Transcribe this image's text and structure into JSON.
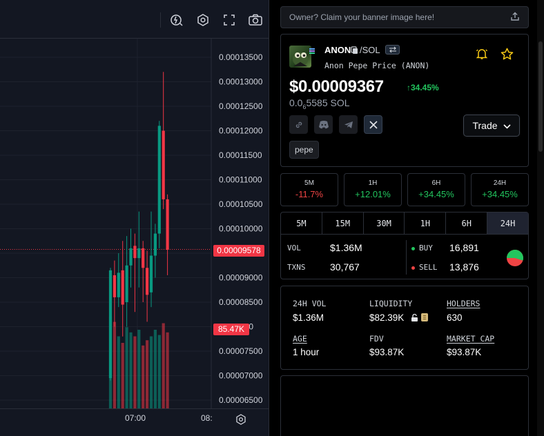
{
  "chart": {
    "price_axis": [
      "0.00013500",
      "0.00013000",
      "0.00012500",
      "0.00012000",
      "0.00011500",
      "0.00011000",
      "0.00010500",
      "0.00010000",
      "0.00009000",
      "0.00008500",
      "0.00007500",
      "0.00007000",
      "0.00006500"
    ],
    "partial_price_label": "000",
    "current_price_tag": "0.00009578",
    "volume_tag": "85.47K",
    "time_labels": [
      "07:00",
      "08:"
    ],
    "candles": [
      {
        "o": 6.95e-05,
        "c": 9.15e-05,
        "h": 9.2e-05,
        "l": 6.9e-05,
        "v": 70
      },
      {
        "o": 9.05e-05,
        "c": 8.6e-05,
        "h": 9.35e-05,
        "l": 8e-05,
        "v": 66
      },
      {
        "o": 8.6e-05,
        "c": 9.1e-05,
        "h": 9.5e-05,
        "l": 8.4e-05,
        "v": 55
      },
      {
        "o": 9.15e-05,
        "c": 8.45e-05,
        "h": 9.75e-05,
        "l": 7.8e-05,
        "v": 50
      },
      {
        "o": 8.5e-05,
        "c": 9.25e-05,
        "h": 9.85e-05,
        "l": 8e-05,
        "v": 62
      },
      {
        "o": 9.25e-05,
        "c": 9.6e-05,
        "h": 0.0001,
        "l": 8.8e-05,
        "v": 58
      },
      {
        "o": 9.65e-05,
        "c": 9.4e-05,
        "h": 9.9e-05,
        "l": 8.3e-05,
        "v": 55
      },
      {
        "o": 9.4e-05,
        "c": 9.6e-05,
        "h": 0.0001035,
        "l": 8.8e-05,
        "v": 60
      },
      {
        "o": 9.6e-05,
        "c": 9.2e-05,
        "h": 9.75e-05,
        "l": 8.5e-05,
        "v": 48
      },
      {
        "o": 9.2e-05,
        "c": 8.65e-05,
        "h": 9.55e-05,
        "l": 8.1e-05,
        "v": 52
      },
      {
        "o": 8.7e-05,
        "c": 9.45e-05,
        "h": 0.0001035,
        "l": 8.4e-05,
        "v": 55
      },
      {
        "o": 9.45e-05,
        "c": 9.9e-05,
        "h": 0.000101,
        "l": 9e-05,
        "v": 60
      },
      {
        "o": 9.9e-05,
        "c": 0.000121,
        "h": 0.000122,
        "l": 9.6e-05,
        "v": 56
      },
      {
        "o": 0.00012,
        "c": 0.000106,
        "h": 0.000132,
        "l": 0.000104,
        "v": 65
      },
      {
        "o": 0.000106,
        "c": 9.57e-05,
        "h": 0.000107,
        "l": 9.05e-05,
        "v": 58
      }
    ]
  },
  "banner": {
    "text": "Owner? Claim your banner image here!"
  },
  "token": {
    "symbol": "ANON",
    "quote": "/SOL",
    "fullname": "Anon Pepe Price (ANON)",
    "price_usd": "$0.00009367",
    "change_24h": "34.45%",
    "price_native_prefix": "0.0",
    "price_native_sub": "6",
    "price_native_rest": "5585 SOL",
    "trade_label": "Trade",
    "tag": "pepe"
  },
  "changes": [
    {
      "label": "5M",
      "value": "-11.7%",
      "direction": "down"
    },
    {
      "label": "1H",
      "value": "+12.01%",
      "direction": "up"
    },
    {
      "label": "6H",
      "value": "+34.45%",
      "direction": "up"
    },
    {
      "label": "24H",
      "value": "+34.45%",
      "direction": "up"
    }
  ],
  "timeframes": [
    "5M",
    "15M",
    "30M",
    "1H",
    "6H",
    "24H"
  ],
  "active_timeframe": "24H",
  "stats": {
    "vol_label": "VOL",
    "vol_value": "$1.36M",
    "txns_label": "TXNS",
    "txns_value": "30,767",
    "buy_label": "BUY",
    "buy_value": "16,891",
    "sell_label": "SELL",
    "sell_value": "13,876",
    "buy_fraction": 0.549
  },
  "metrics": {
    "vol24_label": "24H VOL",
    "vol24_value": "$1.36M",
    "liquidity_label": "LIQUIDITY",
    "liquidity_value": "$82.39K",
    "holders_label": "HOLDERS",
    "holders_value": "630",
    "age_label": "AGE",
    "age_value": "1 hour",
    "fdv_label": "FDV",
    "fdv_value": "$93.87K",
    "mcap_label": "MARKET CAP",
    "mcap_value": "$93.87K"
  },
  "colors": {
    "up": "#22c55e",
    "down": "#ef4444",
    "candle_up": "#089981",
    "candle_down": "#f23645",
    "chart_bg": "#131722",
    "panel_bg": "#000000"
  },
  "icons": [
    "replay-icon",
    "settings-icon",
    "fullscreen-icon",
    "camera-icon",
    "share-icon",
    "copy-icon",
    "swap-icon",
    "bell-icon",
    "star-icon",
    "link-icon",
    "discord-icon",
    "telegram-icon",
    "x-icon",
    "chevron-down-icon",
    "lock-icon",
    "coin-icon"
  ]
}
